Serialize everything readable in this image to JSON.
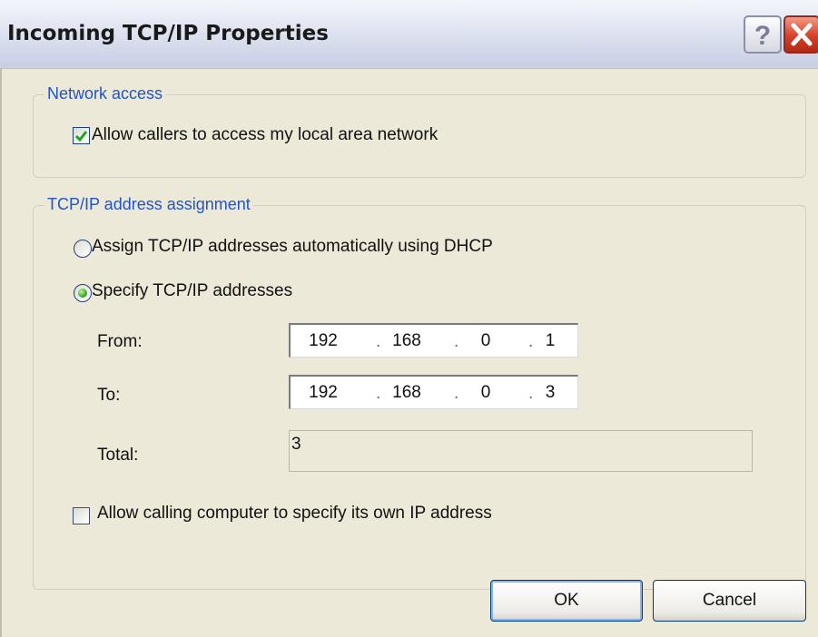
{
  "window": {
    "title": "Incoming TCP/IP Properties",
    "help_glyph": "?",
    "close_glyph": "✕"
  },
  "network_access": {
    "legend": "Network access",
    "allow_lan_label": "Allow callers to access my local area network",
    "allow_lan_checked": true
  },
  "assignment": {
    "legend": "TCP/IP address assignment",
    "dhcp_label": "Assign TCP/IP addresses automatically using DHCP",
    "specify_label": "Specify TCP/IP addresses",
    "selected": "specify",
    "from_label": "From:",
    "from_ip": [
      "192",
      "168",
      "0",
      "1"
    ],
    "to_label": "To:",
    "to_ip": [
      "192",
      "168",
      "0",
      "3"
    ],
    "ip_separator": ".",
    "total_label": "Total:",
    "total_value": "3",
    "allow_own_ip_label": "Allow calling computer to specify its own IP address",
    "allow_own_ip_checked": false
  },
  "buttons": {
    "ok": "OK",
    "cancel": "Cancel"
  },
  "colors": {
    "legend": "#2153c9",
    "check_mark": "#21a121",
    "close_button": "#d6402a"
  }
}
